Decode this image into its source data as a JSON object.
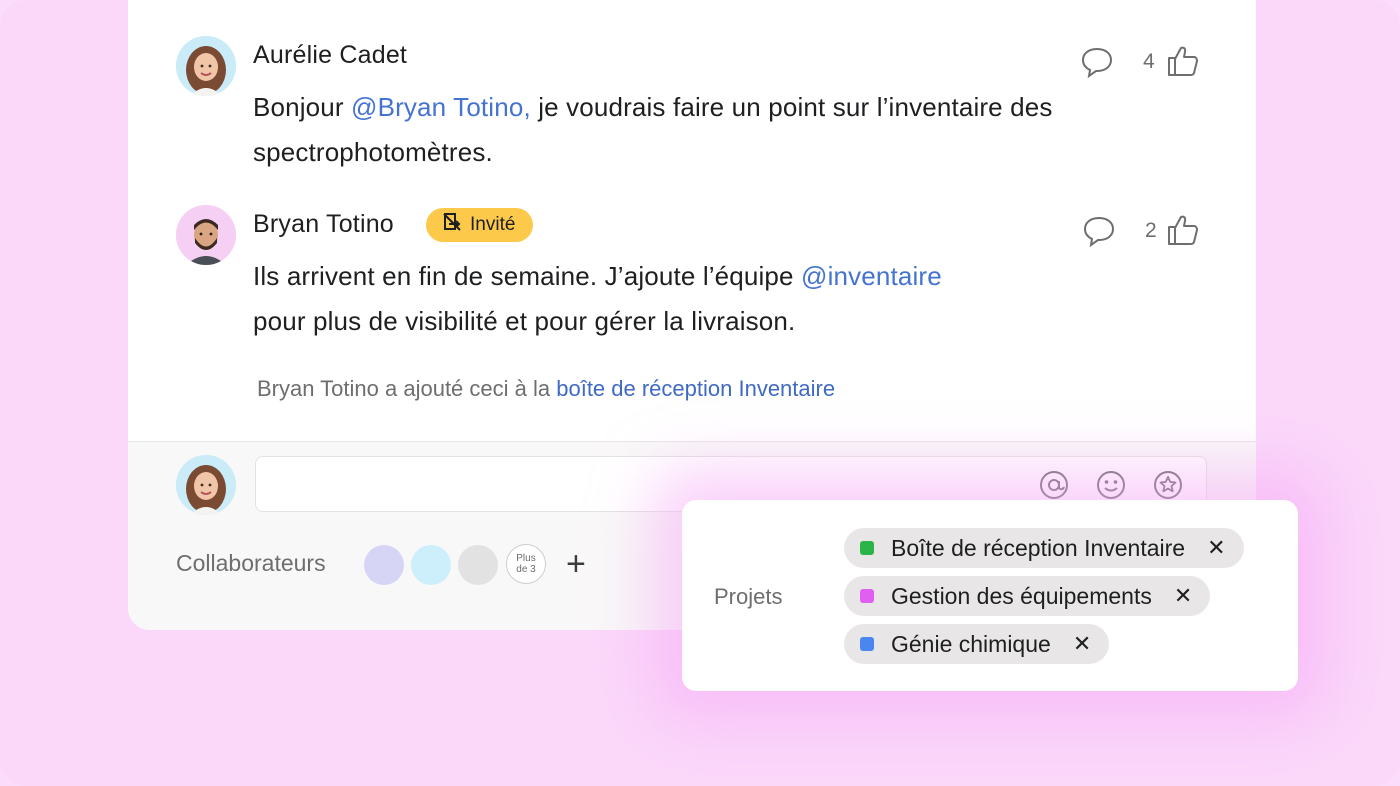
{
  "comments": [
    {
      "author": "Aurélie Cadet",
      "text_before": "Bonjour ",
      "mention": "@Bryan Totino,",
      "text_after": " je voudrais faire un point sur l’inventaire des spectrophotomètres.",
      "likes": "4"
    },
    {
      "author": "Bryan Totino",
      "badge": "Invité",
      "line1_before": "Ils arrivent en fin de semaine. J’ajoute l’équipe ",
      "mention": "@inventaire",
      "line2": "pour plus de visibilité et pour gérer la livraison.",
      "likes": "2"
    }
  ],
  "activity": {
    "text": "Bryan Totino a ajouté ceci à la ",
    "link": "boîte de réception Inventaire"
  },
  "composer": {
    "icons": [
      "at-icon",
      "emoji-icon",
      "star-icon"
    ]
  },
  "collaborators": {
    "label": "Collaborateurs",
    "colors": [
      "#d6d5f5",
      "#cdeefb",
      "#e3e2e2"
    ],
    "more_line1": "Plus",
    "more_line2": "de 3",
    "add": "+"
  },
  "projects": {
    "label": "Projets",
    "items": [
      {
        "name": "Boîte de réception Inventaire",
        "color": "#2ab44a"
      },
      {
        "name": "Gestion des équipements",
        "color": "#e05ef0"
      },
      {
        "name": "Génie chimique",
        "color": "#4a85f0"
      }
    ],
    "remove_symbol": "✕"
  },
  "colors": {
    "mention": "#4573d2",
    "badge": "#fdc94a",
    "background": "#fbd8fa"
  }
}
